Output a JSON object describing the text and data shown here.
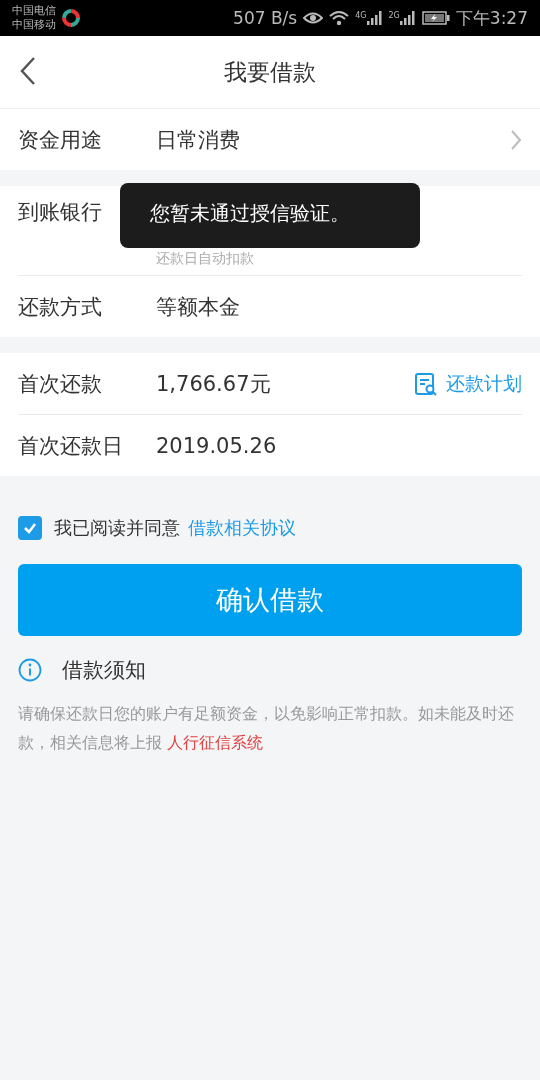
{
  "status_bar": {
    "carriers": [
      "中国电信",
      "中国移动"
    ],
    "speed": "507 B/s",
    "networks": [
      "4G",
      "2G"
    ],
    "time": "下午3:27"
  },
  "header": {
    "title": "我要借款"
  },
  "sections": [
    {
      "rows": [
        {
          "label": "资金用途",
          "value": "日常消费",
          "chevron": true
        }
      ]
    },
    {
      "rows": [
        {
          "label": "到账银行",
          "note": "还款日自动扣款"
        },
        {
          "label": "还款方式",
          "value": "等额本金"
        }
      ]
    },
    {
      "rows": [
        {
          "label": "首次还款",
          "value": "1,766.67元",
          "action": "还款计划"
        },
        {
          "label": "首次还款日",
          "value": "2019.05.26"
        }
      ]
    }
  ],
  "agreement": {
    "checked": true,
    "text": "我已阅读并同意",
    "link": "借款相关协议"
  },
  "confirm_button": "确认借款",
  "notice": {
    "title": "借款须知",
    "text": "请确保还款日您的账户有足额资金，以免影响正常扣款。如未能及时还款，相关信息将上报",
    "link": "人行征信系统"
  },
  "toast": "您暂未通过授信验证。"
}
